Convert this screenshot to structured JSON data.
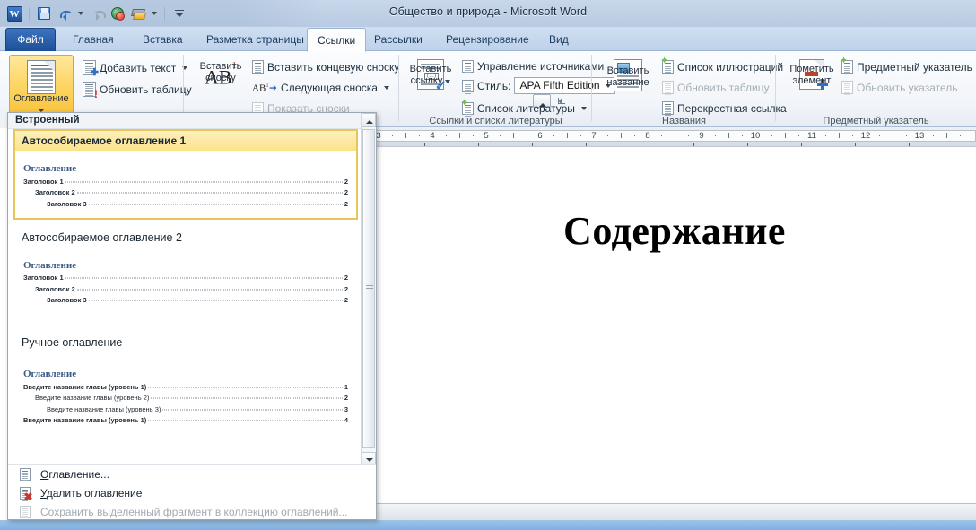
{
  "window": {
    "title": "Общество и природа  -  Microsoft Word",
    "app_logo": "W"
  },
  "quick_access": {
    "items": [
      {
        "name": "word-logo",
        "icon": "word-logo-icon",
        "label": "W"
      },
      {
        "name": "save",
        "icon": "save-icon"
      },
      {
        "name": "undo",
        "icon": "undo-icon"
      },
      {
        "name": "undo-dropdown",
        "icon": "chevron-down-icon"
      },
      {
        "name": "redo",
        "icon": "redo-icon"
      },
      {
        "name": "web-preview",
        "icon": "globe-icon"
      },
      {
        "name": "format-painter",
        "icon": "brush-icon"
      },
      {
        "name": "format-painter-dropdown",
        "icon": "chevron-down-icon"
      },
      {
        "name": "customize-toolbar",
        "icon": "bar-chevron-icon"
      }
    ]
  },
  "tabs": [
    {
      "label": "Файл",
      "kind": "file"
    },
    {
      "label": "Главная",
      "kind": "normal"
    },
    {
      "label": "Вставка",
      "kind": "normal"
    },
    {
      "label": "Разметка страницы",
      "kind": "normal"
    },
    {
      "label": "Ссылки",
      "kind": "active"
    },
    {
      "label": "Рассылки",
      "kind": "normal"
    },
    {
      "label": "Рецензирование",
      "kind": "normal"
    },
    {
      "label": "Вид",
      "kind": "normal"
    }
  ],
  "ribbon": {
    "groups": [
      {
        "name": "toc",
        "label": "",
        "big_button": {
          "label_line1": "Оглавление",
          "icon": "toc-icon",
          "has_dropdown": true,
          "selected": true
        },
        "items": [
          {
            "label": "Добавить текст",
            "icon": "add-text-icon",
            "dropdown": true,
            "disabled": false
          },
          {
            "label": "Обновить таблицу",
            "icon": "update-table-icon",
            "dropdown": false,
            "disabled": false
          }
        ]
      },
      {
        "name": "footnotes",
        "label": "",
        "big_button": {
          "label_line1": "Вставить",
          "label_line2": "сноску",
          "icon": "ab1-icon"
        },
        "items": [
          {
            "label": "Вставить концевую сноску",
            "icon": "endnote-icon",
            "dropdown": false,
            "disabled": false
          },
          {
            "label": "Следующая сноска",
            "icon": "next-footnote-icon",
            "dropdown": true,
            "disabled": false
          },
          {
            "label": "Показать сноски",
            "icon": "show-notes-icon",
            "dropdown": false,
            "disabled": true
          }
        ]
      },
      {
        "name": "citations",
        "label": "Ссылки и списки литературы",
        "big_button": {
          "label_line1": "Вставить",
          "label_line2": "ссылку",
          "icon": "insert-citation-icon",
          "has_dropdown": true
        },
        "items": [
          {
            "label": "Управление источниками",
            "icon": "manage-sources-icon",
            "dropdown": false,
            "disabled": false
          },
          {
            "label": "Стиль:",
            "icon": "style-icon",
            "dropdown": false,
            "disabled": false,
            "combo_value": "APA Fifth Edition"
          },
          {
            "label": "Список литературы",
            "icon": "bibliography-icon",
            "dropdown": true,
            "disabled": false
          }
        ]
      },
      {
        "name": "captions",
        "label": "Названия",
        "big_button": {
          "label_line1": "Вставить",
          "label_line2": "название",
          "icon": "insert-caption-icon"
        },
        "items": [
          {
            "label": "Список иллюстраций",
            "icon": "table-of-figures-icon",
            "dropdown": false,
            "disabled": false
          },
          {
            "label": "Обновить таблицу",
            "icon": "update-table-icon",
            "dropdown": false,
            "disabled": true
          },
          {
            "label": "Перекрестная ссылка",
            "icon": "cross-reference-icon",
            "dropdown": false,
            "disabled": false
          }
        ]
      },
      {
        "name": "index",
        "label": "Предметный указатель",
        "big_button": {
          "label_line1": "Пометить",
          "label_line2": "элемент",
          "icon": "mark-entry-icon"
        },
        "items": [
          {
            "label": "Предметный указатель",
            "icon": "insert-index-icon",
            "dropdown": false,
            "disabled": false
          },
          {
            "label": "Обновить указатель",
            "icon": "update-index-icon",
            "dropdown": false,
            "disabled": true
          }
        ]
      }
    ]
  },
  "gallery": {
    "header": "Встроенный",
    "items": [
      {
        "name": "auto-toc-1",
        "title": "Автособираемое оглавление 1",
        "selected": true,
        "preview_title": "Оглавление",
        "lines": [
          {
            "text": "Заголовок 1",
            "page": "2",
            "level": 1
          },
          {
            "text": "Заголовок 2",
            "page": "2",
            "level": 2
          },
          {
            "text": "Заголовок 3",
            "page": "2",
            "level": 3
          }
        ]
      },
      {
        "name": "auto-toc-2",
        "title": "Автособираемое оглавление 2",
        "selected": false,
        "preview_title": "Оглавление",
        "lines": [
          {
            "text": "Заголовок 1",
            "page": "2",
            "level": 1
          },
          {
            "text": "Заголовок 2",
            "page": "2",
            "level": 2
          },
          {
            "text": "Заголовок 3",
            "page": "2",
            "level": 3
          }
        ]
      },
      {
        "name": "manual-toc",
        "title": "Ручное оглавление",
        "selected": false,
        "preview_title": "Оглавление",
        "lines": [
          {
            "text": "Введите название главы (уровень 1)",
            "page": "1",
            "level": 1
          },
          {
            "text": "Введите название главы (уровень 2)",
            "page": "2",
            "level": 2
          },
          {
            "text": "Введите название главы (уровень 3)",
            "page": "3",
            "level": 3
          },
          {
            "text": "Введите название главы (уровень 1)",
            "page": "4",
            "level": 1
          }
        ]
      }
    ],
    "menu": [
      {
        "name": "toc-dialog",
        "label": "Оглавление...",
        "icon": "toc-small-icon",
        "disabled": false
      },
      {
        "name": "remove-toc",
        "label": "Удалить оглавление",
        "icon": "remove-toc-icon",
        "disabled": false
      },
      {
        "name": "save-selection-to-toc-gallery",
        "label": "Сохранить выделенный фрагмент в коллекцию оглавлений...",
        "icon": "save-selection-icon",
        "disabled": true
      }
    ]
  },
  "ruler": {
    "numbers": [
      "3",
      "4",
      "5",
      "6",
      "7",
      "8",
      "9",
      "10",
      "11",
      "12",
      "13"
    ],
    "unit_start": 3
  },
  "document": {
    "heading": "Содержание"
  },
  "colors": {
    "accent": "#1d4f96",
    "selection": "#fbe38b",
    "toc_heading": "#3c5a86",
    "status_strip": "#9dc3e6"
  }
}
